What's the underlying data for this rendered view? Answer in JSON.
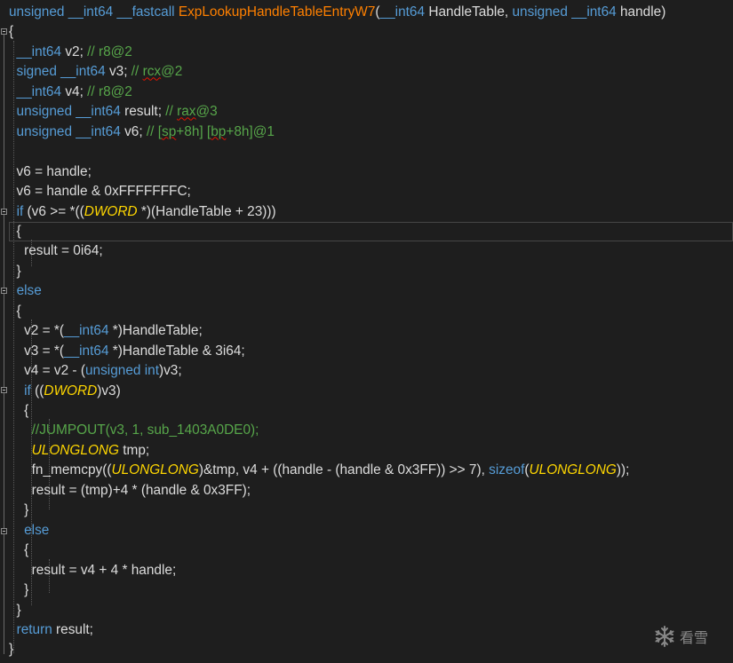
{
  "editor": {
    "lines": [
      [
        {
          "t": "unsigned __int64 __fastcall ",
          "c": "kw"
        },
        {
          "t": "ExpLookupHandleTableEntryW7",
          "c": "fn"
        },
        {
          "t": "(",
          "c": "op"
        },
        {
          "t": "__int64 ",
          "c": "kw"
        },
        {
          "t": "HandleTable, ",
          "c": "op"
        },
        {
          "t": "unsigned __int64 ",
          "c": "kw"
        },
        {
          "t": "handle)",
          "c": "op"
        }
      ],
      [
        {
          "t": "{",
          "c": "op"
        }
      ],
      [
        {
          "t": "  __int64 ",
          "c": "kw"
        },
        {
          "t": "v2; ",
          "c": "op"
        },
        {
          "t": "// r8@2",
          "c": "cm"
        }
      ],
      [
        {
          "t": "  signed __int64 ",
          "c": "kw"
        },
        {
          "t": "v3; ",
          "c": "op"
        },
        {
          "t": "// ",
          "c": "cm"
        },
        {
          "t": "rcx",
          "c": "cm squig"
        },
        {
          "t": "@2",
          "c": "cm"
        }
      ],
      [
        {
          "t": "  __int64 ",
          "c": "kw"
        },
        {
          "t": "v4; ",
          "c": "op"
        },
        {
          "t": "// r8@2",
          "c": "cm"
        }
      ],
      [
        {
          "t": "  unsigned __int64 ",
          "c": "kw"
        },
        {
          "t": "result; ",
          "c": "op"
        },
        {
          "t": "// ",
          "c": "cm"
        },
        {
          "t": "rax",
          "c": "cm squig"
        },
        {
          "t": "@3",
          "c": "cm"
        }
      ],
      [
        {
          "t": "  unsigned __int64 ",
          "c": "kw"
        },
        {
          "t": "v6; ",
          "c": "op"
        },
        {
          "t": "// [",
          "c": "cm"
        },
        {
          "t": "sp",
          "c": "cm squig"
        },
        {
          "t": "+8h] [",
          "c": "cm"
        },
        {
          "t": "bp",
          "c": "cm squig"
        },
        {
          "t": "+8h]@1",
          "c": "cm"
        }
      ],
      [],
      [
        {
          "t": "  v6 = handle;",
          "c": "op"
        }
      ],
      [
        {
          "t": "  v6 = handle & 0xFFFFFFFC;",
          "c": "op"
        }
      ],
      [
        {
          "t": "  ",
          "c": "op"
        },
        {
          "t": "if ",
          "c": "kw"
        },
        {
          "t": "(v6 >= *((",
          "c": "op"
        },
        {
          "t": "DWORD ",
          "c": "ty"
        },
        {
          "t": "*)(HandleTable + 23)))",
          "c": "op"
        }
      ],
      [
        {
          "t": "  {",
          "c": "op"
        }
      ],
      [
        {
          "t": "    result = 0i64;",
          "c": "op"
        }
      ],
      [
        {
          "t": "  }",
          "c": "op"
        }
      ],
      [
        {
          "t": "  ",
          "c": "op"
        },
        {
          "t": "else",
          "c": "kw"
        }
      ],
      [
        {
          "t": "  {",
          "c": "op"
        }
      ],
      [
        {
          "t": "    v2 = *(",
          "c": "op"
        },
        {
          "t": "__int64 ",
          "c": "kw"
        },
        {
          "t": "*)HandleTable;",
          "c": "op"
        }
      ],
      [
        {
          "t": "    v3 = *(",
          "c": "op"
        },
        {
          "t": "__int64 ",
          "c": "kw"
        },
        {
          "t": "*)HandleTable & 3i64;",
          "c": "op"
        }
      ],
      [
        {
          "t": "    v4 = v2 - (",
          "c": "op"
        },
        {
          "t": "unsigned int",
          "c": "kw"
        },
        {
          "t": ")v3;",
          "c": "op"
        }
      ],
      [
        {
          "t": "    ",
          "c": "op"
        },
        {
          "t": "if ",
          "c": "kw"
        },
        {
          "t": "((",
          "c": "op"
        },
        {
          "t": "DWORD",
          "c": "ty"
        },
        {
          "t": ")v3)",
          "c": "op"
        }
      ],
      [
        {
          "t": "    {",
          "c": "op"
        }
      ],
      [
        {
          "t": "      ",
          "c": "op"
        },
        {
          "t": "//JUMPOUT(v3, 1, sub_1403A0DE0);",
          "c": "cm"
        }
      ],
      [
        {
          "t": "      ",
          "c": "op"
        },
        {
          "t": "ULONGLONG ",
          "c": "ty"
        },
        {
          "t": "tmp;",
          "c": "op"
        }
      ],
      [
        {
          "t": "      fn_memcpy((",
          "c": "op"
        },
        {
          "t": "ULONGLONG",
          "c": "ty"
        },
        {
          "t": ")&tmp, v4 + ((handle - (handle & 0x3FF)) >> 7), ",
          "c": "op"
        },
        {
          "t": "sizeof",
          "c": "kw"
        },
        {
          "t": "(",
          "c": "op"
        },
        {
          "t": "ULONGLONG",
          "c": "ty"
        },
        {
          "t": "));",
          "c": "op"
        }
      ],
      [
        {
          "t": "      result = (tmp)+4 * (handle & 0x3FF);",
          "c": "op"
        }
      ],
      [
        {
          "t": "    }",
          "c": "op"
        }
      ],
      [
        {
          "t": "    ",
          "c": "op"
        },
        {
          "t": "else",
          "c": "kw"
        }
      ],
      [
        {
          "t": "    {",
          "c": "op"
        }
      ],
      [
        {
          "t": "      result = v4 + 4 * handle;",
          "c": "op"
        }
      ],
      [
        {
          "t": "    }",
          "c": "op"
        }
      ],
      [
        {
          "t": "  }",
          "c": "op"
        }
      ],
      [
        {
          "t": "  ",
          "c": "op"
        },
        {
          "t": "return ",
          "c": "kw"
        },
        {
          "t": "result;",
          "c": "op"
        }
      ],
      [
        {
          "t": "}",
          "c": "op"
        }
      ]
    ]
  },
  "watermark": {
    "icon": "snowflake-icon",
    "text": "看雪"
  }
}
